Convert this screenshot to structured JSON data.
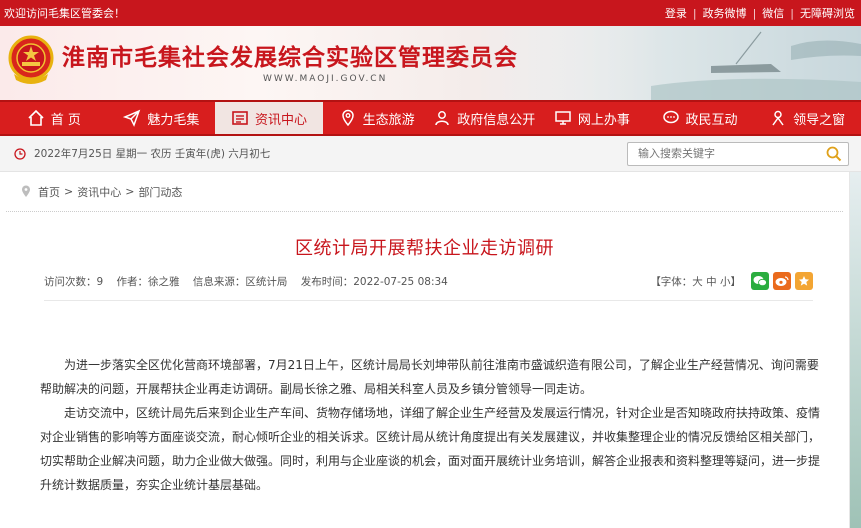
{
  "topbar": {
    "welcome": "欢迎访问毛集区管委会！",
    "links": [
      "登录",
      "政务微博",
      "微信",
      "无障碍浏览"
    ]
  },
  "header": {
    "title": "淮南市毛集社会发展综合实验区管理委员会",
    "url": "WWW.MAOJI.GOV.CN"
  },
  "nav": [
    {
      "label": "首 页",
      "icon": "home-icon"
    },
    {
      "label": "魅力毛集",
      "icon": "paper-plane-icon"
    },
    {
      "label": "资讯中心",
      "icon": "news-icon"
    },
    {
      "label": "生态旅游",
      "icon": "map-pin-icon"
    },
    {
      "label": "政府信息公开",
      "icon": "people-icon"
    },
    {
      "label": "网上办事",
      "icon": "monitor-icon"
    },
    {
      "label": "政民互动",
      "icon": "chat-icon"
    },
    {
      "label": "领导之窗",
      "icon": "person-icon"
    }
  ],
  "active_nav": 2,
  "date_text": "2022年7月25日 星期一 农历 壬寅年(虎) 六月初七",
  "search": {
    "placeholder": "输入搜索关键字"
  },
  "breadcrumb": [
    "首页",
    "资讯中心",
    "部门动态"
  ],
  "article": {
    "title": "区统计局开展帮扶企业走访调研",
    "meta": {
      "visits": "访问次数：9",
      "author": "作者：徐之雅",
      "source": "信息来源：区统计局",
      "time": "发布时间：2022-07-25 08:34",
      "font_size": "【字体：大 中 小】"
    },
    "paragraphs": [
      "为进一步落实全区优化营商环境部署，7月21日上午，区统计局局长刘坤带队前往淮南市盛诚织造有限公司，了解企业生产经营情况、询问需要帮助解决的问题，开展帮扶企业再走访调研。副局长徐之雅、局相关科室人员及乡镇分管领导一同走访。",
      "走访交流中，区统计局先后来到企业生产车间、货物存储场地，详细了解企业生产经营及发展运行情况，针对企业是否知晓政府扶持政策、疫情对企业销售的影响等方面座谈交流，耐心倾听企业的相关诉求。区统计局从统计角度提出有关发展建议，并收集整理企业的情况反馈给区相关部门，切实帮助企业解决问题，助力企业做大做强。同时，利用与企业座谈的机会，面对面开展统计业务培训，解答企业报表和资料整理等疑问，进一步提升统计数据质量，夯实企业统计基层基础。"
    ]
  },
  "colors": {
    "brand_red": "#c8161d",
    "nav_red": "#d81e1e"
  }
}
